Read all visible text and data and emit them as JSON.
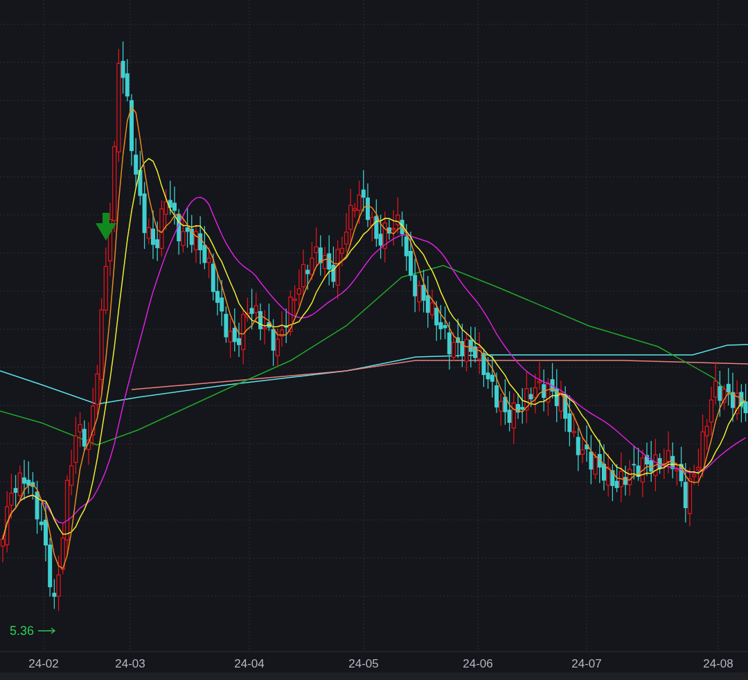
{
  "chart": {
    "low_marker": {
      "label": "5.36"
    },
    "x_axis_labels": [
      "24-02",
      "24-03",
      "24-04",
      "24-05",
      "24-06",
      "24-07",
      "24-08"
    ]
  }
}
